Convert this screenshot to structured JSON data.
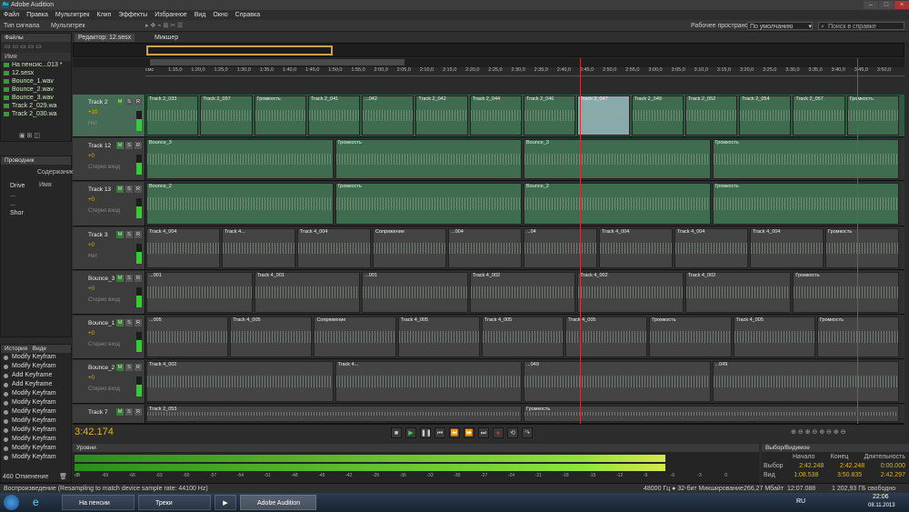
{
  "window": {
    "title": "Adobe Audition"
  },
  "menu": [
    "Файл",
    "Правка",
    "Мультитрек",
    "Клип",
    "Эффекты",
    "Избранное",
    "Вид",
    "Окно",
    "Справка"
  ],
  "toolbar": {
    "waveform": "Тип сигнала",
    "multitrack": "Мультитрек",
    "workspace_label": "Рабочее пространство:",
    "workspace_value": "По умолчанию",
    "search_placeholder": "Поиск в справке"
  },
  "files_panel": {
    "title": "Файлы",
    "column": "Имя",
    "items": [
      "На пенсис...013 *",
      "12.sesx",
      "Bounce_1.wav",
      "Bounce_2.wav",
      "Bounce_3.wav",
      "Track 2_029.wa",
      "Track 2_030.wa"
    ]
  },
  "media_panel": {
    "title": "Проводник",
    "content_label": "Содержание",
    "name_col": "Имя",
    "items": [
      "Drive",
      "...",
      "...",
      "Shor"
    ]
  },
  "history_panel": {
    "title": "История",
    "tab2": "Виде",
    "items": [
      "Modify Keyfram",
      "Modify Keyfram",
      "Add Keyframe",
      "Add Keyframe",
      "Modify Keyfram",
      "Modify Keyfram",
      "Modify Keyfram",
      "Modify Keyfram",
      "Modify Keyfram",
      "Modify Keyfram",
      "Modify Keyfram",
      "Modify Keyfram"
    ],
    "count": "460 Отменение"
  },
  "editor": {
    "tab_active": "Редактор: 12.sesx",
    "tab_mixer": "Микшер"
  },
  "ruler": [
    "смс",
    "1:15,0",
    "1:20,0",
    "1:25,0",
    "1:30,0",
    "1:35,0",
    "1:40,0",
    "1:45,0",
    "1:50,0",
    "1:55,0",
    "2:00,0",
    "2:05,0",
    "2:10,0",
    "2:15,0",
    "2:20,0",
    "2:25,0",
    "2:30,0",
    "2:35,0",
    "2:40,0",
    "2:45,0",
    "2:50,0",
    "2:55,0",
    "3:00,0",
    "3:05,0",
    "3:10,0",
    "3:15,0",
    "3:20,0",
    "3:25,0",
    "3:30,0",
    "3:35,0",
    "3:40,0",
    "3:45,0",
    "3:50,0"
  ],
  "tracks": [
    {
      "name": "Track 2",
      "vol": "+10",
      "input": "Нет",
      "clips": [
        "Track 2_033",
        "Track 2_037",
        "Громкость",
        "Track 2_041",
        "...042",
        "Track 2_042",
        "Track 2_044",
        "Track 2_046",
        "Track 2_047",
        "Track 2_049",
        "Track 2_052",
        "Track 2_054",
        "Track 2_057",
        "Громкость"
      ]
    },
    {
      "name": "Track 12",
      "vol": "+0",
      "input": "Стерео вход",
      "clips": [
        "Bounce_3",
        "Громкость",
        "Bounce_3",
        "Громкость"
      ]
    },
    {
      "name": "Track 13",
      "vol": "+0",
      "input": "Стерео вход",
      "clips": [
        "Bounce_2",
        "Громкость",
        "Bounce_2",
        "Громкость"
      ]
    },
    {
      "name": "Track 3",
      "vol": "+0",
      "input": "Нет",
      "clips": [
        "Track 4_004",
        "Track 4...",
        "Track 4_004",
        "Сопряжение",
        "...004",
        "...04",
        "Track 4_004",
        "Track 4_004",
        "Track 4_004",
        "Громкость"
      ]
    },
    {
      "name": "Bounce_3",
      "vol": "+0",
      "input": "Стерео вход",
      "clips": [
        "...001",
        "Track 4_001",
        "...001",
        "Track 4_002",
        "Track 4_002",
        "Track 4_002",
        "Громкость"
      ]
    },
    {
      "name": "Bounce_1",
      "vol": "+0",
      "input": "Стерео вход",
      "clips": [
        "...005",
        "Track 4_005",
        "Сопряжение",
        "Track 4_005",
        "Track 4_005",
        "Track 4_005",
        "Громкость",
        "Track 4_005",
        "Громкость"
      ]
    },
    {
      "name": "Bounce_2",
      "vol": "+0",
      "input": "Стерео вход",
      "clips": [
        "Track 4_002",
        "Track 4...",
        "...049",
        "...049"
      ]
    },
    {
      "name": "Track 7",
      "vol": "+0",
      "input": "",
      "clips": [
        "Track 2_053",
        "Громкость"
      ]
    }
  ],
  "transport": {
    "time": "3:42.174"
  },
  "levels": {
    "title": "Уровни",
    "scale": [
      "dB",
      "-69",
      "-66",
      "-63",
      "-60",
      "-57",
      "-54",
      "-51",
      "-48",
      "-45",
      "-42",
      "-39",
      "-36",
      "-33",
      "-30",
      "-27",
      "-24",
      "-21",
      "-18",
      "-15",
      "-12",
      "-9",
      "-6",
      "-3",
      "0"
    ]
  },
  "selection": {
    "title": "Выбор/Видимое",
    "cols": [
      "Начало",
      "Конец",
      "Длительность"
    ],
    "rows": [
      {
        "label": "Выбор",
        "start": "2:42.248",
        "end": "2:42.248",
        "dur": "0:00.000"
      },
      {
        "label": "Вид",
        "start": "1:08.538",
        "end": "3:50.835",
        "dur": "2:42.297"
      }
    ]
  },
  "status": {
    "left": "Воспроизведение (Resampling to match device sample rate: 44100 Hz)",
    "format": "48000 Гц ● 32-бит Микширование",
    "mem": "266,27 Мбайт",
    "dur": "12:07.088",
    "free": "1 202,93 ГБ свободно"
  },
  "taskbar": {
    "items": [
      "На пенсии",
      "Треки",
      "",
      "Adobe Audition"
    ],
    "lang": "RU",
    "time": "22:06",
    "date": "08.11.2013"
  },
  "colors": {
    "accent": "#e6b400",
    "clip_green": "#3f6b4e",
    "playhead": "#cc3333"
  }
}
